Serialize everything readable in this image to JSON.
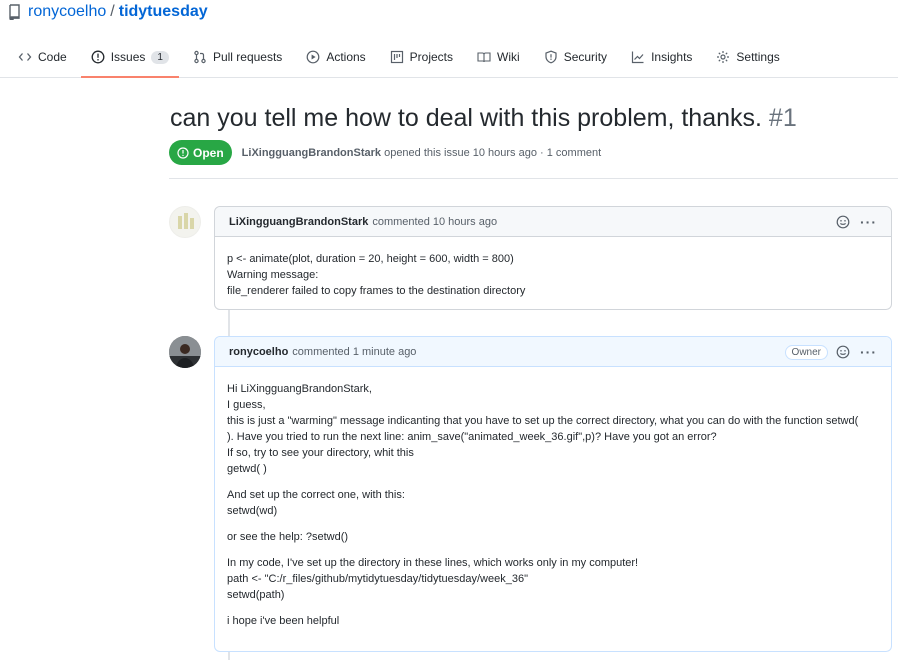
{
  "repo": {
    "owner": "ronycoelho",
    "separator": "/",
    "name": "tidytuesday"
  },
  "tabs": [
    {
      "label": "Code",
      "icon": "code-icon"
    },
    {
      "label": "Issues",
      "icon": "issue-icon",
      "count": "1",
      "active": true
    },
    {
      "label": "Pull requests",
      "icon": "pull-request-icon"
    },
    {
      "label": "Actions",
      "icon": "play-icon"
    },
    {
      "label": "Projects",
      "icon": "project-icon"
    },
    {
      "label": "Wiki",
      "icon": "book-icon"
    },
    {
      "label": "Security",
      "icon": "shield-icon"
    },
    {
      "label": "Insights",
      "icon": "graph-icon"
    },
    {
      "label": "Settings",
      "icon": "gear-icon"
    }
  ],
  "issue": {
    "title": "can you tell me how to deal with this problem, thanks.",
    "number": "#1",
    "state": "Open",
    "author": "LiXingguangBrandonStark",
    "meta_text": "opened this issue 10 hours ago · 1 comment"
  },
  "comments": [
    {
      "author": "LiXingguangBrandonStark",
      "action": "commented 10 hours ago",
      "paragraphs": [
        [
          "p <- animate(plot, duration = 20, height = 600, width = 800)",
          "Warning message:",
          "file_renderer failed to copy frames to the destination directory"
        ]
      ]
    },
    {
      "author": "ronycoelho",
      "action": "commented 1 minute ago",
      "badge": "Owner",
      "paragraphs": [
        [
          "Hi LiXingguangBrandonStark,",
          "I guess,",
          "this is just a \"warming\" message indicanting that you have to set up the correct directory, what you can do with the function setwd(",
          "). Have you tried to run the next line: anim_save(\"animated_week_36.gif\",p)? Have you got an error?",
          "If so, try to see your directory, whit this",
          "getwd( )"
        ],
        [
          "And set up the correct one, with this:",
          "setwd(wd)"
        ],
        [
          "or see the help: ?setwd()"
        ],
        [
          "In my code, I've set up the directory in these lines, which works only in my computer!",
          "path <- \"C:/r_files/github/mytidytuesday/tidytuesday/week_36\"",
          "setwd(path)"
        ],
        [
          "i hope i've been helpful"
        ]
      ]
    }
  ],
  "colors": {
    "accent_tab": "#f9826c",
    "open_badge": "#28a745",
    "link": "#0366d6"
  }
}
